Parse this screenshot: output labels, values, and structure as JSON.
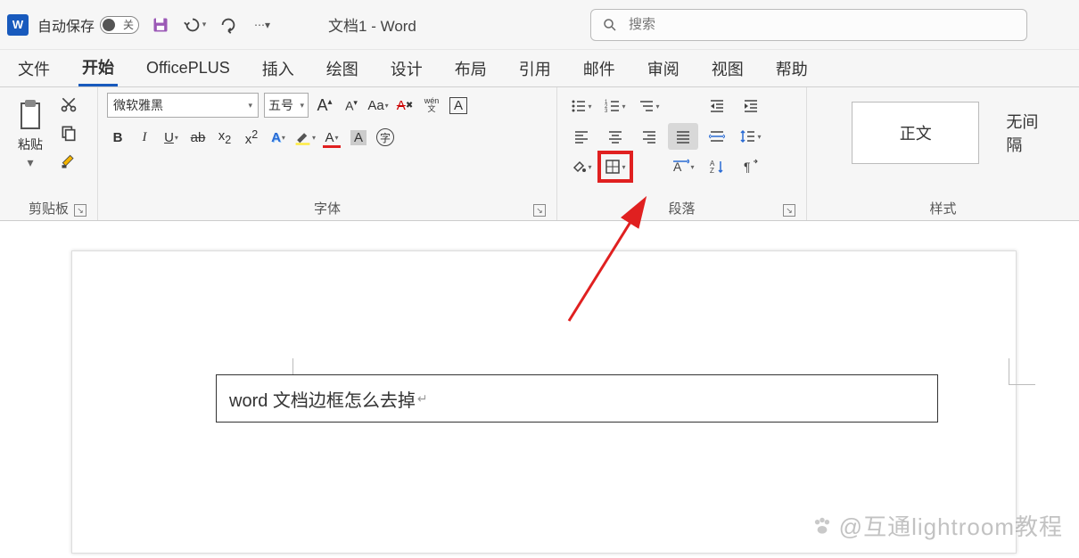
{
  "titlebar": {
    "autosave_label": "自动保存",
    "autosave_state": "关",
    "doc_title": "文档1  -  Word",
    "search_placeholder": "搜索"
  },
  "tabs": [
    "文件",
    "开始",
    "OfficePLUS",
    "插入",
    "绘图",
    "设计",
    "布局",
    "引用",
    "邮件",
    "审阅",
    "视图",
    "帮助"
  ],
  "active_tab": "开始",
  "ribbon": {
    "clipboard": {
      "paste": "粘贴",
      "label": "剪贴板"
    },
    "font": {
      "name": "微软雅黑",
      "size": "五号",
      "label": "字体",
      "phonetic": "wén\n文"
    },
    "paragraph": {
      "label": "段落"
    },
    "styles": {
      "normal": "正文",
      "no_spacing": "无间隔",
      "label": "样式"
    }
  },
  "document": {
    "text": "word 文档边框怎么去掉",
    "end_mark": "↵"
  },
  "watermark": "@互通lightroom教程"
}
